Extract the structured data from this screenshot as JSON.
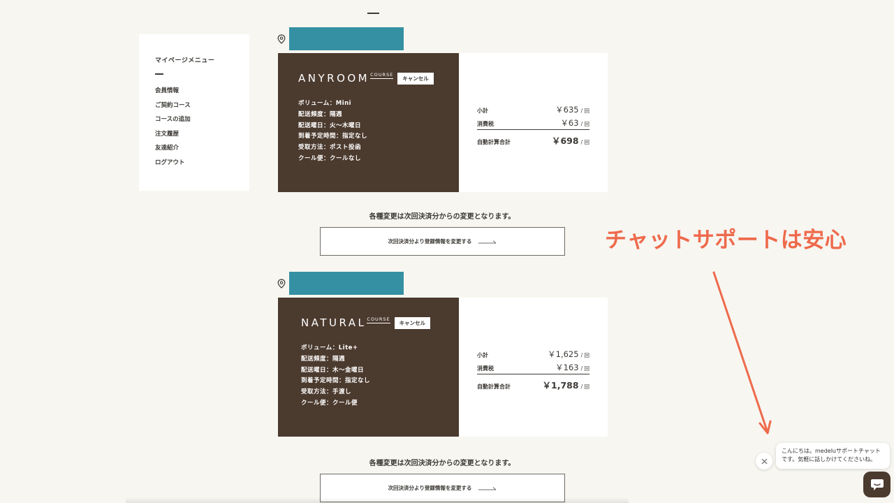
{
  "sidebar": {
    "title": "マイページメニュー",
    "items": [
      "会員情報",
      "ご契約コース",
      "コースの追加",
      "注文履歴",
      "友達紹介",
      "ログアウト"
    ]
  },
  "courses": [
    {
      "name": "ANYROOM",
      "tag": "COURSE",
      "cancel": "キャンセル",
      "specs": [
        "ボリューム：Mini",
        "配送頻度：隔週",
        "配送曜日：火〜木曜日",
        "到着予定時間：指定なし",
        "受取方法：ポスト投函",
        "クール便：クールなし"
      ],
      "subtotal_label": "小計",
      "subtotal": "￥635",
      "tax_label": "消費税",
      "tax": "￥63",
      "total_label": "自動計算合計",
      "total": "￥698",
      "unit": "/ 回",
      "note": "各種変更は次回決済分からの変更となります。",
      "change_button": "次回決済分より登録情報を変更する"
    },
    {
      "name": "NATURAL",
      "tag": "COURSE",
      "cancel": "キャンセル",
      "specs": [
        "ボリューム：Lite+",
        "配送頻度：隔週",
        "配送曜日：木〜金曜日",
        "到着予定時間：指定なし",
        "受取方法：手渡し",
        "クール便：クール便"
      ],
      "subtotal_label": "小計",
      "subtotal": "￥1,625",
      "tax_label": "消費税",
      "tax": "￥163",
      "total_label": "自動計算合計",
      "total": "￥1,788",
      "unit": "/ 回",
      "note": "各種変更は次回決済分からの変更となります。",
      "change_button": "次回決済分より登録情報を変更する"
    }
  ],
  "annotation": {
    "text": "チャットサポートは安心",
    "color": "#ee6a4c"
  },
  "chat": {
    "line1": "こんにちは。medeluサポートチャット",
    "line2": "です。気軽に話しかけてくださいね。",
    "close_icon": "close-icon",
    "button_icon": "chat-icon"
  },
  "colors": {
    "brown": "#4b3a2e",
    "teal": "#3590a3",
    "background": "#f7f6f1"
  }
}
